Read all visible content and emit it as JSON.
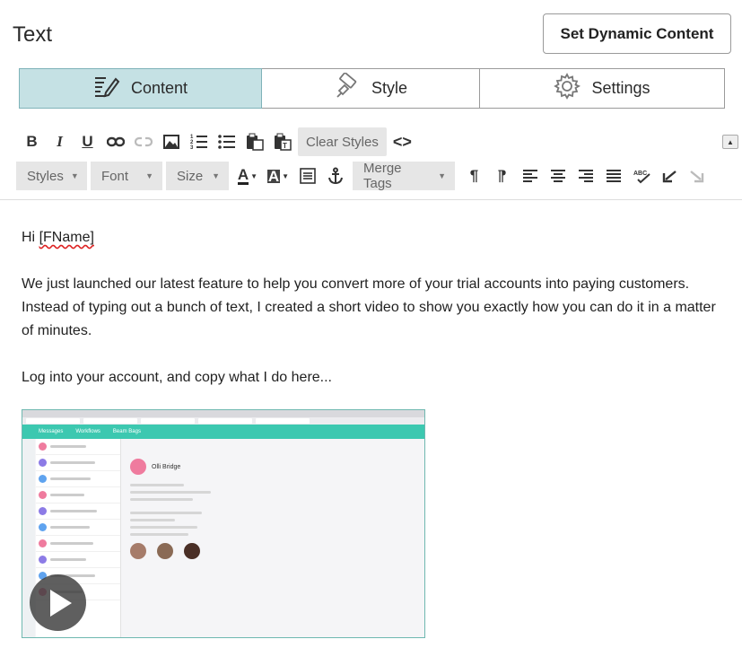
{
  "header": {
    "title": "Text",
    "dynamic_button": "Set Dynamic Content"
  },
  "tabs": [
    {
      "label": "Content",
      "icon": "edit-icon",
      "active": true
    },
    {
      "label": "Style",
      "icon": "paint-icon",
      "active": false
    },
    {
      "label": "Settings",
      "icon": "gear-icon",
      "active": false
    }
  ],
  "toolbar": {
    "bold": "B",
    "italic": "I",
    "underline": "U",
    "clear_styles": "Clear Styles",
    "source": "<>",
    "styles": "Styles",
    "font": "Font",
    "size": "Size",
    "text_color": "A",
    "bg_color": "A",
    "merge_tags": "Merge Tags",
    "pilcrow": "¶",
    "spellcheck": "ABC"
  },
  "body": {
    "greeting_prefix": "Hi ",
    "merge_field": "[FName]",
    "paragraph1": "We just launched our latest feature to help you convert more of your trial accounts into paying customers. Instead of typing out a bunch of text, I created a short video to show you exactly how you can do it in a matter of minutes.",
    "paragraph2": "Log into your account, and copy what I do here..."
  },
  "video": {
    "app_name": "Messages",
    "tabs": [
      "Messages",
      "Workflows",
      "Beam Bags"
    ],
    "contact_name": "Olli Bridge"
  },
  "colors": {
    "active_tab": "#c5e1e4",
    "app_accent": "#3cc8b0"
  }
}
